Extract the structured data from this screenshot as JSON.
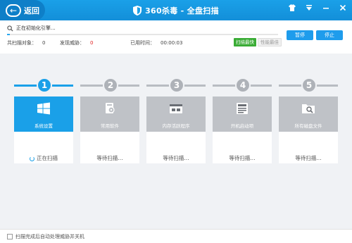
{
  "titlebar": {
    "back_label": "返回",
    "title": "360杀毒 - 全盘扫描",
    "controls": [
      "skin-icon",
      "menu-icon",
      "minimize-icon",
      "close-icon"
    ]
  },
  "status": {
    "current_action": "正在初始化引擎...",
    "progress_fraction": 0.01,
    "pause_label": "暂停",
    "stop_label": "停止",
    "scanned_label": "共扫描对象：",
    "scanned_value": "0",
    "threats_label": "发现威胁：",
    "threats_value": "0",
    "elapsed_label": "已用时间：",
    "elapsed_value": "00:00:03",
    "mode_fast": "扫描最快",
    "mode_best": "性能最佳"
  },
  "steps": [
    {
      "number": "1",
      "label": "系统设置",
      "status": "正在扫描",
      "active": true,
      "icon": "windows-icon"
    },
    {
      "number": "2",
      "label": "常用软件",
      "status": "等待扫描...",
      "active": false,
      "icon": "software-icon"
    },
    {
      "number": "3",
      "label": "内存活跃程序",
      "status": "等待扫描...",
      "active": false,
      "icon": "memory-icon"
    },
    {
      "number": "4",
      "label": "开机启动项",
      "status": "等待扫描...",
      "active": false,
      "icon": "startup-icon"
    },
    {
      "number": "5",
      "label": "所有磁盘文件",
      "status": "等待扫描...",
      "active": false,
      "icon": "disk-files-icon"
    }
  ],
  "footer": {
    "auto_handle_label": "扫描完成后自动处理威胁并关机",
    "auto_handle_checked": false
  },
  "colors": {
    "accent": "#1aa0e8",
    "inactive": "#bfc2c7",
    "threat": "#e02020",
    "mode_active": "#3aac35"
  }
}
